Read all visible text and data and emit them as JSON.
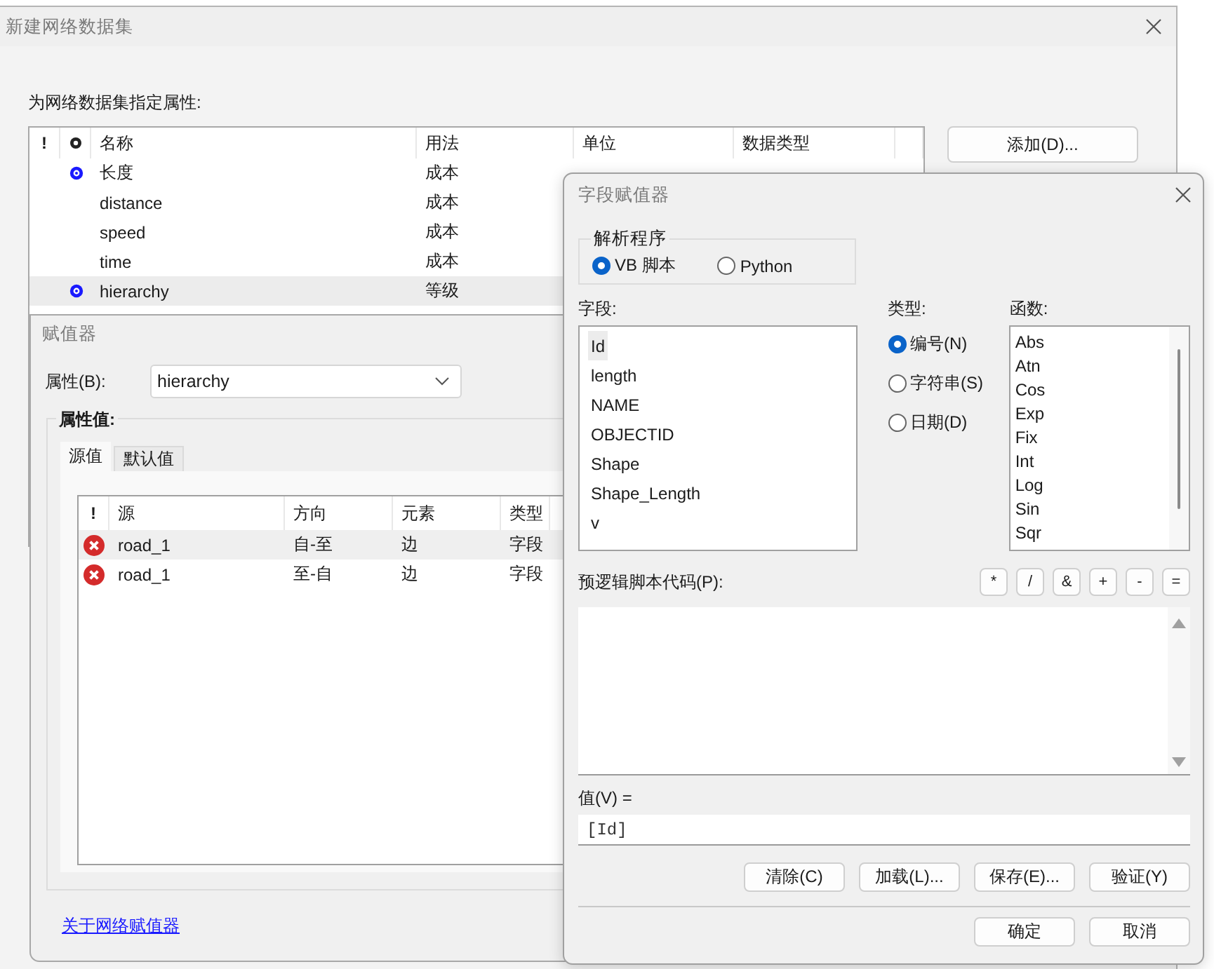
{
  "main_dialog": {
    "title": "新建网络数据集",
    "prompt": "为网络数据集指定属性:",
    "table": {
      "columns": [
        {
          "label": "!"
        },
        {
          "kind": "icon"
        },
        {
          "label": "名称"
        },
        {
          "label": "用法"
        },
        {
          "label": "单位"
        },
        {
          "label": "数据类型"
        }
      ],
      "rows": [
        {
          "marked": true,
          "name": "长度",
          "usage": "成本",
          "selected": false
        },
        {
          "marked": false,
          "name": "distance",
          "usage": "成本",
          "selected": false
        },
        {
          "marked": false,
          "name": "speed",
          "usage": "成本",
          "selected": false
        },
        {
          "marked": false,
          "name": "time",
          "usage": "成本",
          "selected": false
        },
        {
          "marked": true,
          "name": "hierarchy",
          "usage": "等级",
          "selected": true
        }
      ]
    },
    "add_button": "添加(D)..."
  },
  "assigner_dialog": {
    "title": "赋值器",
    "attribute_label": "属性(B):",
    "attribute_value": "hierarchy",
    "group_label": "属性值:",
    "tabs": [
      {
        "label": "源值",
        "selected": true
      },
      {
        "label": "默认值",
        "selected": false
      }
    ],
    "table": {
      "columns": [
        "!",
        "源",
        "方向",
        "元素",
        "类型"
      ],
      "rows": [
        {
          "kind": "error",
          "source": "road_1",
          "direction": "自-至",
          "element": "边",
          "type": "字段",
          "selected": true
        },
        {
          "kind": "error",
          "source": "road_1",
          "direction": "至-自",
          "element": "边",
          "type": "字段",
          "selected": false
        }
      ]
    },
    "link": "关于网络赋值器"
  },
  "field_dialog": {
    "title": "字段赋值器",
    "parser": {
      "label": "解析程序",
      "options": [
        {
          "label": "VB 脚本",
          "selected": true
        },
        {
          "label": "Python",
          "selected": false
        }
      ]
    },
    "fields_label": "字段:",
    "fields": [
      {
        "label": "Id",
        "selected": true
      },
      {
        "label": "length",
        "selected": false
      },
      {
        "label": "NAME",
        "selected": false
      },
      {
        "label": "OBJECTID",
        "selected": false
      },
      {
        "label": "Shape",
        "selected": false
      },
      {
        "label": "Shape_Length",
        "selected": false
      },
      {
        "label": "v",
        "selected": false
      }
    ],
    "type_label": "类型:",
    "types": [
      {
        "label": "编号(N)",
        "selected": true
      },
      {
        "label": "字符串(S)",
        "selected": false
      },
      {
        "label": "日期(D)",
        "selected": false
      }
    ],
    "functions_label": "函数:",
    "functions": [
      {
        "label": "Abs",
        "selected": false
      },
      {
        "label": "Atn",
        "selected": false
      },
      {
        "label": "Cos",
        "selected": false
      },
      {
        "label": "Exp",
        "selected": false
      },
      {
        "label": "Fix",
        "selected": false
      },
      {
        "label": "Int",
        "selected": false
      },
      {
        "label": "Log",
        "selected": false
      },
      {
        "label": "Sin",
        "selected": false
      },
      {
        "label": "Sqr",
        "selected": false
      }
    ],
    "script_label": "预逻辑脚本代码(P):",
    "operators": [
      "*",
      "/",
      "&",
      "+",
      "-",
      "="
    ],
    "value_label": "值(V) =",
    "value": "[Id]",
    "action_buttons": [
      "清除(C)",
      "加载(L)...",
      "保存(E)...",
      "验证(Y)"
    ],
    "footer_buttons": [
      "确定",
      "取消"
    ]
  }
}
